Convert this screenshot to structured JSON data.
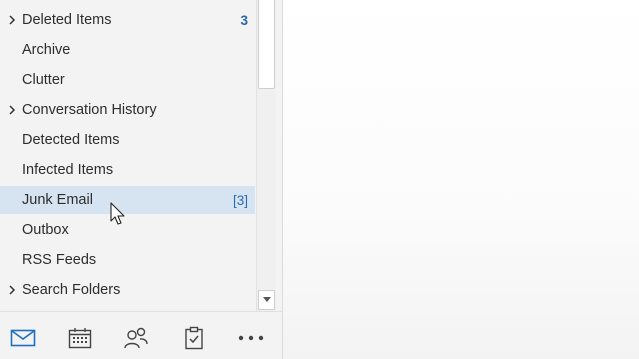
{
  "folders": [
    {
      "label": "Deleted Items",
      "count": "3",
      "count_style": "bold",
      "expandable": true,
      "selected": false
    },
    {
      "label": "Archive",
      "count": "",
      "expandable": false,
      "selected": false
    },
    {
      "label": "Clutter",
      "count": "",
      "expandable": false,
      "selected": false
    },
    {
      "label": "Conversation History",
      "count": "",
      "expandable": true,
      "selected": false
    },
    {
      "label": "Detected Items",
      "count": "",
      "expandable": false,
      "selected": false
    },
    {
      "label": "Infected Items",
      "count": "",
      "expandable": false,
      "selected": false
    },
    {
      "label": "Junk Email",
      "count": "[3]",
      "count_style": "bracket",
      "expandable": false,
      "selected": true
    },
    {
      "label": "Outbox",
      "count": "",
      "expandable": false,
      "selected": false
    },
    {
      "label": "RSS Feeds",
      "count": "",
      "expandable": false,
      "selected": false
    },
    {
      "label": "Search Folders",
      "count": "",
      "expandable": true,
      "selected": false
    }
  ],
  "nav": {
    "items": [
      {
        "name": "mail-icon",
        "active": true
      },
      {
        "name": "calendar-icon",
        "active": false
      },
      {
        "name": "people-icon",
        "active": false
      },
      {
        "name": "tasks-icon",
        "active": false
      },
      {
        "name": "more-icon",
        "active": false
      }
    ]
  },
  "colors": {
    "accent": "#2b6cb0",
    "selected_bg": "#d6e4f1",
    "pane_bg": "#f3f3f3"
  }
}
